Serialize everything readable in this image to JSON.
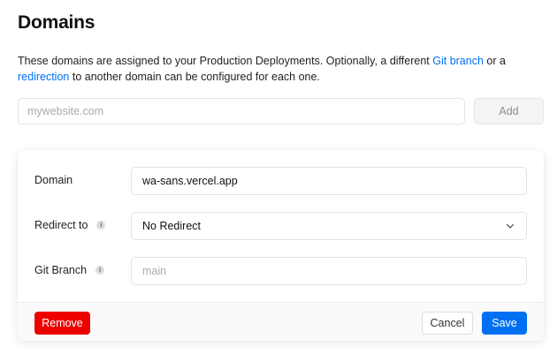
{
  "page": {
    "title": "Domains",
    "description_part1": "These domains are assigned to your Production Deployments. Optionally, a different ",
    "git_branch_link": "Git branch",
    "description_part2": " or a ",
    "redirection_link": "redirection",
    "description_part3": " to another domain can be configured for each one."
  },
  "add_domain": {
    "placeholder": "mywebsite.com",
    "value": "",
    "add_label": "Add"
  },
  "domain_card": {
    "domain_label": "Domain",
    "domain_value": "wa-sans.vercel.app",
    "redirect_label": "Redirect to",
    "redirect_value": "No Redirect",
    "git_branch_label": "Git Branch",
    "git_branch_placeholder": "main",
    "git_branch_value": "",
    "info_glyph": "i",
    "remove_label": "Remove",
    "cancel_label": "Cancel",
    "save_label": "Save"
  },
  "colors": {
    "accent": "#0070f3",
    "danger": "#ee0000"
  },
  "icons": {
    "info": "info-icon",
    "chevron": "chevron-down-icon"
  }
}
